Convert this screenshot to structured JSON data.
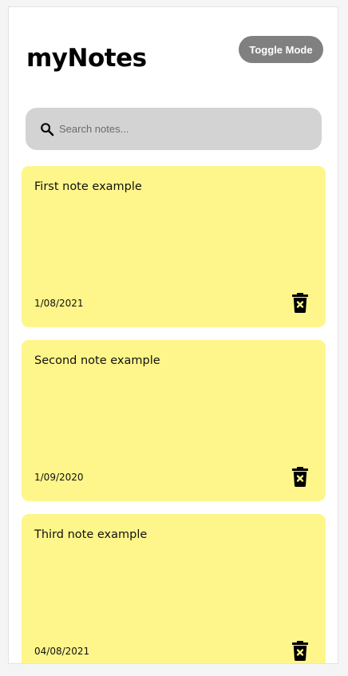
{
  "header": {
    "title": "myNotes",
    "toggle_label": "Toggle Mode"
  },
  "search": {
    "placeholder": "Search notes...",
    "value": "",
    "icon": "search-icon"
  },
  "notes": [
    {
      "text": "First note example",
      "date": "1/08/2021",
      "delete_icon": "trash-delete-icon"
    },
    {
      "text": "Second note example",
      "date": "1/09/2020",
      "delete_icon": "trash-delete-icon"
    },
    {
      "text": "Third note example",
      "date": "04/08/2021",
      "delete_icon": "trash-delete-icon"
    }
  ],
  "colors": {
    "note_background": "#fef68a",
    "search_background": "#d3d3d3",
    "toggle_background": "#808080"
  }
}
